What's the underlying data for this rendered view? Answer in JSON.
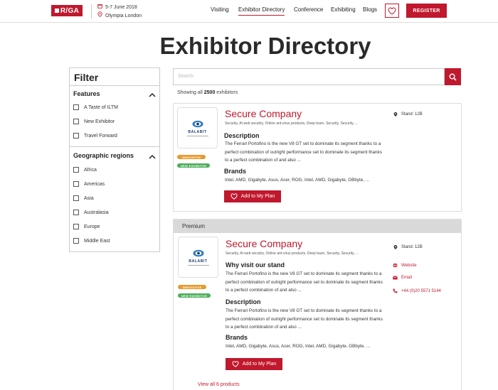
{
  "header": {
    "logo_text": "R/GA",
    "event_date": "5-7 June 2018",
    "event_venue": "Olympia London",
    "nav": [
      "Visiting",
      "Exhibitor Directory",
      "Conference",
      "Exhibiting",
      "Blogs"
    ],
    "active_nav": "Exhibitor Directory",
    "register_label": "REGISTER"
  },
  "page_title": "Exhibitor Directory",
  "filter": {
    "title": "Filter",
    "sections": [
      {
        "title": "Features",
        "items": [
          "A Taste of ILTM",
          "New Exhibitor",
          "Travel Forward"
        ]
      },
      {
        "title": "Geographic regions",
        "items": [
          "Africa",
          "Americas",
          "Asia",
          "Australasia",
          "Europe",
          "Middle East"
        ]
      }
    ]
  },
  "search": {
    "placeholder": "Search"
  },
  "results": {
    "prefix": "Showing all",
    "count": "2500",
    "suffix": "exhibitors"
  },
  "cards": [
    {
      "company": "Secure Company",
      "logo_text": "BALABIT",
      "tags": "Security, AI web secutiry, Online ant-virus products, Deep learn, Security, Security, ...",
      "badges": [
        "INNOVATIVE",
        "NEW EXHIBITOR"
      ],
      "stand": "Stand: 12B",
      "sections": [
        {
          "heading": "Description",
          "text": "The Ferrari Portofino is the new V8 GT set to dominate its segment thanks to a perfect combination of outright performance set to dominate its segment thanks to a perfect combination of and also ..."
        }
      ],
      "brands_heading": "Brands",
      "brands": "Intel, AMD, Gigabyte, Asus, Acer, ROG, Intel, AMD, Gigabyte, GBbyte, ...",
      "plan_label": "Add to My Plan"
    },
    {
      "band": "Premium",
      "company": "Secure Company",
      "logo_text": "BALABIT",
      "tags": "Security, AI web secutiry, Online ant-virus products, Deep learn, Security, Security, ...",
      "badges": [
        "INNOVATIVE",
        "NEW EXHIBITOR"
      ],
      "stand": "Stand: 12B",
      "website": "Website",
      "email": "Email",
      "phone": "+44 (0)20 5571 5144",
      "sections": [
        {
          "heading": "Why visit our stand",
          "text": "The Ferrari Portofino is the new V8 GT set to dominate its segment thanks to a perfect combination of outright performance set to dominate its segment thanks to a perfect combination of and also ..."
        },
        {
          "heading": "Description",
          "text": "The Ferrari Portofino is the new V8 GT set to dominate its segment thanks to a perfect combination of outright performance set to dominate its segment thanks to a perfect combination of and also ..."
        }
      ],
      "brands_heading": "Brands",
      "brands": "Intel, AMD, Gigabyte, Asus, Acer, ROG, Intel, AMD, Gigabyte, GBbyte, ...",
      "plan_label": "Add to My Plan",
      "view_all": "View all 6 products"
    }
  ],
  "colors": {
    "accent": "#c0182d",
    "innovative": "#e89a2c",
    "new_exhibitor": "#4cae5a",
    "premium_band": "#d9d9d9"
  }
}
